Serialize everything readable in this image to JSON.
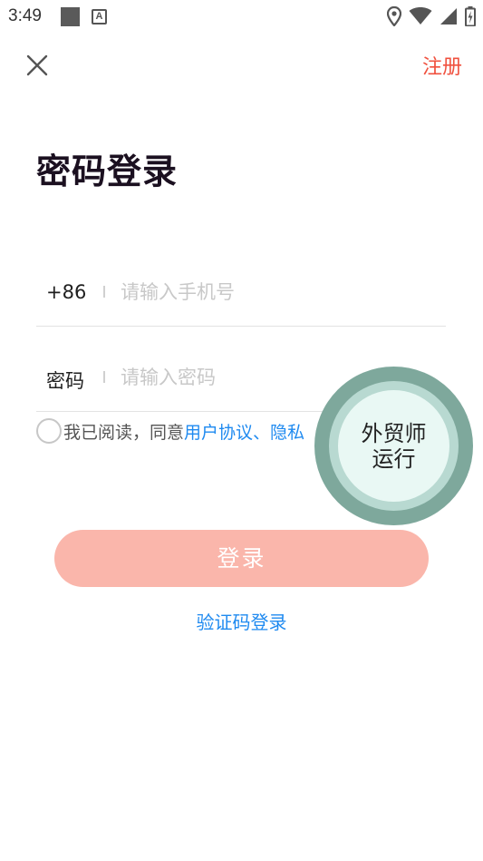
{
  "status_bar": {
    "time": "3:49",
    "notification_icon_letter": "A"
  },
  "header": {
    "close_icon": "close-icon",
    "register_label": "注册"
  },
  "page": {
    "title": "密码登录"
  },
  "phone_field": {
    "prefix": "+86",
    "placeholder": "请输入手机号",
    "value": ""
  },
  "password_field": {
    "prefix": "密码",
    "placeholder": "请输入密码",
    "value": ""
  },
  "agreement": {
    "checked": false,
    "text": "我已阅读，同意",
    "link_text": "用户协议、隐私"
  },
  "floating_bubble": {
    "line1": "外贸师",
    "line2": "运行"
  },
  "login_button": {
    "label": "登录",
    "color": "#fab6ab"
  },
  "alt_login": {
    "label": "验证码登录"
  },
  "colors": {
    "accent_red": "#f0513f",
    "link_blue": "#1f8af0"
  }
}
